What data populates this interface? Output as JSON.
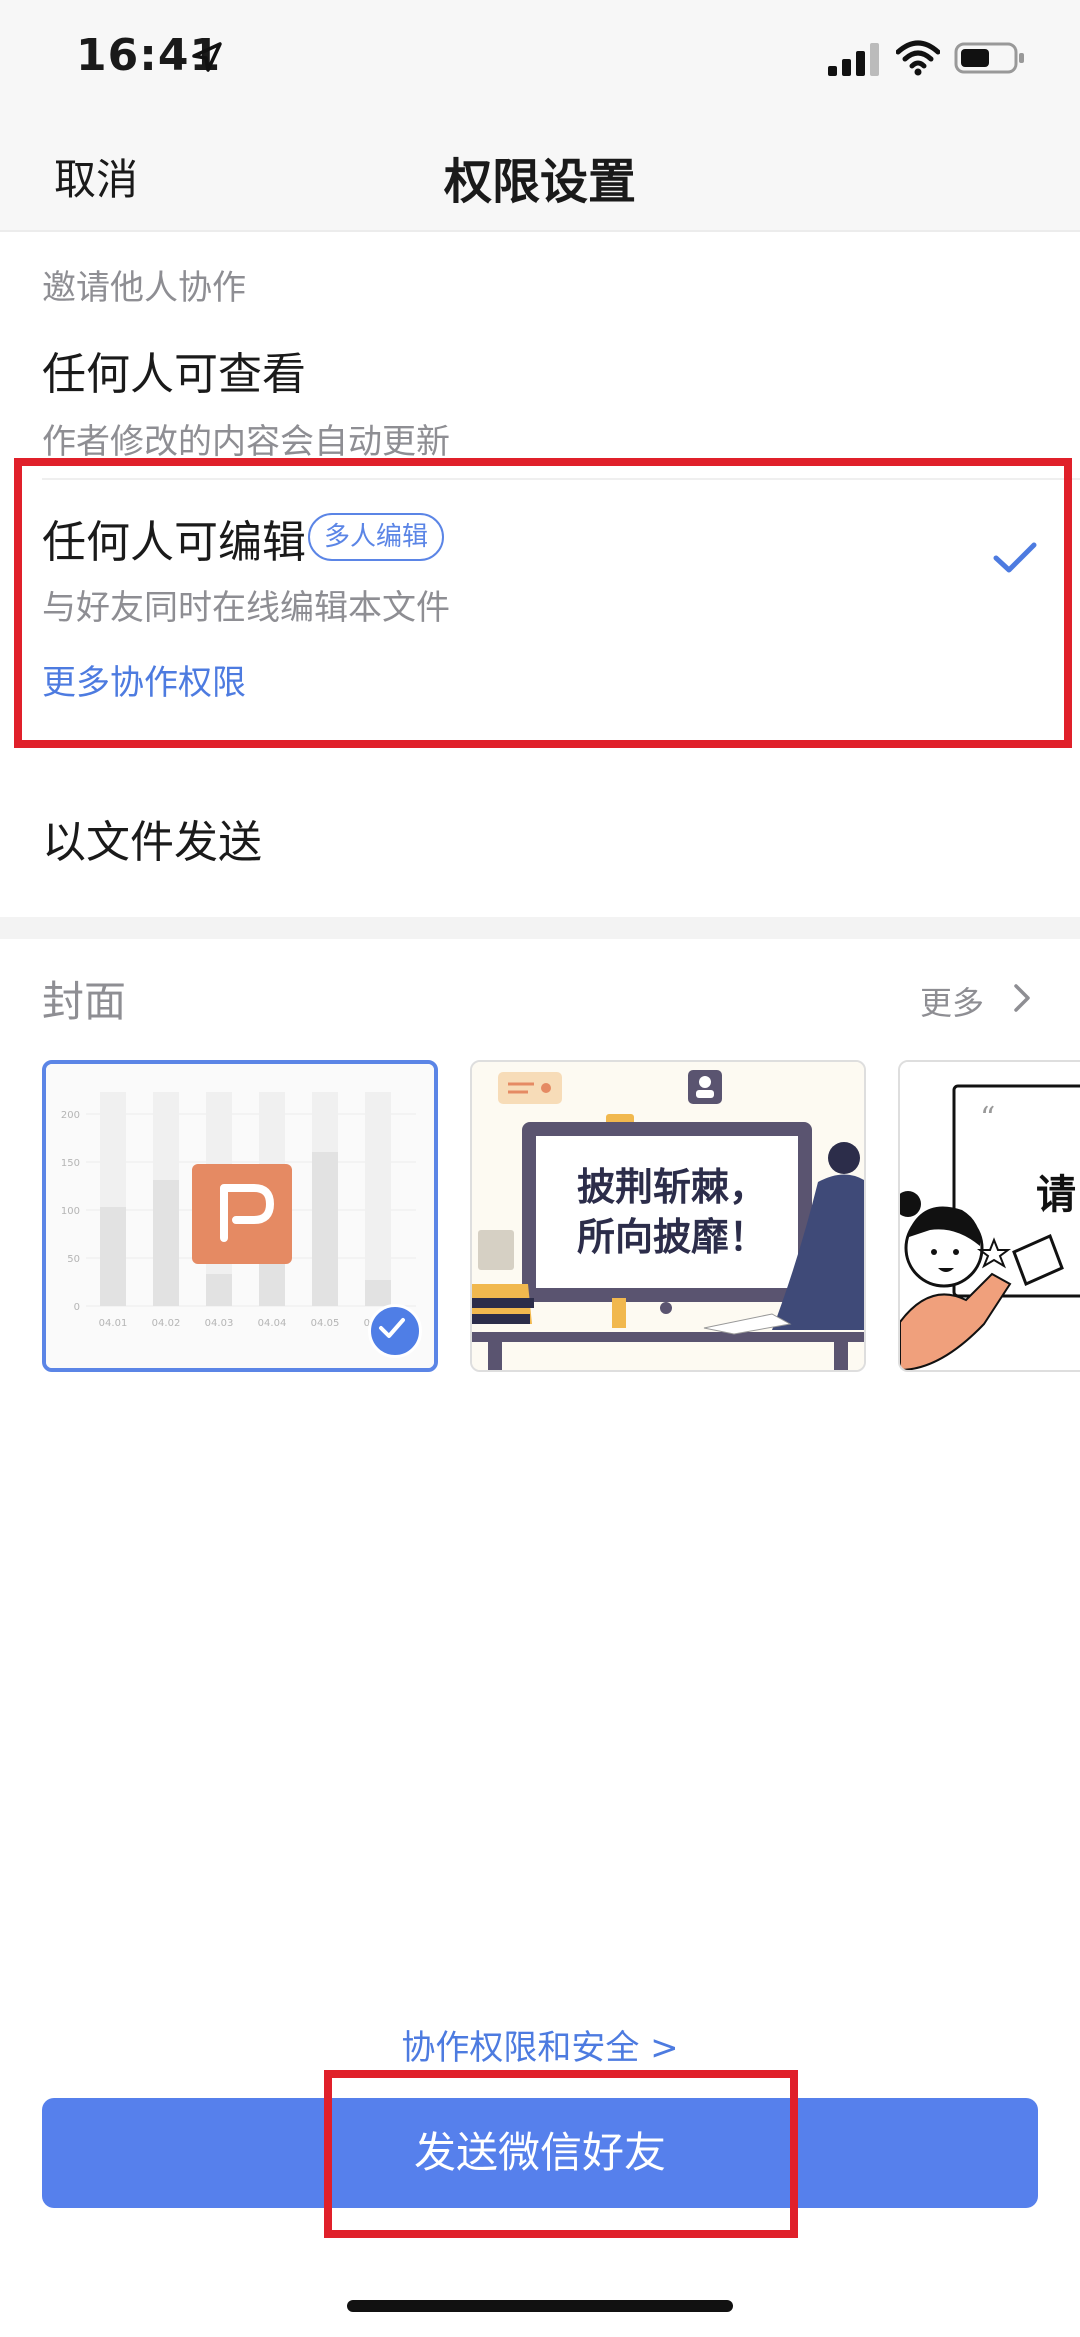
{
  "status_bar": {
    "time": "16:41"
  },
  "nav": {
    "cancel": "取消",
    "title": "权限设置"
  },
  "invite": {
    "section_label": "邀请他人协作",
    "options": [
      {
        "title": "任何人可查看",
        "subtitle": "作者修改的内容会自动更新"
      },
      {
        "title": "任何人可编辑",
        "badge": "多人编辑",
        "subtitle": "与好友同时在线编辑本文件",
        "selected": true,
        "more_link": "更多协作权限"
      },
      {
        "title": "以文件发送"
      }
    ]
  },
  "cover": {
    "label": "封面",
    "more": "更多",
    "items": [
      {
        "kind": "chart-thumbnail",
        "selected": true,
        "y_ticks": [
          "200",
          "150",
          "100",
          "50",
          "0"
        ],
        "x_ticks": [
          "04.01",
          "04.02",
          "04.03",
          "04.04",
          "04.05",
          "04.06"
        ]
      },
      {
        "kind": "illustration",
        "text": "披荆斩棘，所向披靡！"
      },
      {
        "kind": "illustration",
        "text": "请"
      }
    ]
  },
  "footer": {
    "security_link": "协作权限和安全 >",
    "send_button": "发送微信好友"
  },
  "colors": {
    "accent": "#5680ec",
    "link": "#4d7be0",
    "highlight": "#e0202a",
    "secondary_text": "#8e8e93"
  }
}
